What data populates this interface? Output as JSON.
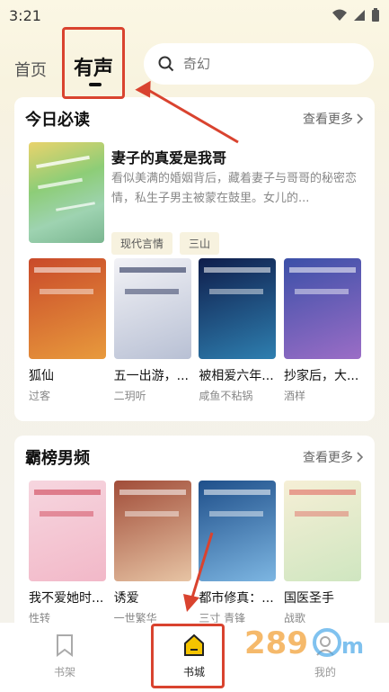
{
  "status": {
    "time": "3:21"
  },
  "top_tabs": {
    "home": "首页",
    "audio": "有声"
  },
  "search": {
    "placeholder": "奇幻"
  },
  "section1": {
    "title": "今日必读",
    "more": "查看更多",
    "feature": {
      "title": "妻子的真爱是我哥",
      "desc": "看似美满的婚姻背后，藏着妻子与哥哥的秘密恋情，私生子男主被蒙在鼓里。女儿的...",
      "tags": [
        "现代言情",
        "三山"
      ]
    },
    "books": [
      {
        "title": "狐仙",
        "author": "过客",
        "color_a": "#c94a2a",
        "color_b": "#e89a3c"
      },
      {
        "title": "五一出游，...",
        "author": "二玥听",
        "color_a": "#e9e9ee",
        "color_b": "#b8c0d4"
      },
      {
        "title": "被相爱六年...",
        "author": "咸鱼不粘锅",
        "color_a": "#0f1d4b",
        "color_b": "#2e7fb0"
      },
      {
        "title": "抄家后，大...",
        "author": "酒样",
        "color_a": "#3b50a8",
        "color_b": "#9b6dc6"
      }
    ]
  },
  "section2": {
    "title": "霸榜男频",
    "more": "查看更多",
    "books": [
      {
        "title": "我不爱她时...",
        "author": "性转",
        "color_a": "#f6d6df",
        "color_b": "#f2b8c8"
      },
      {
        "title": "诱爱",
        "author": "一世繁华",
        "color_a": "#a14d39",
        "color_b": "#e7c4a4"
      },
      {
        "title": "都市修真：...",
        "author": "三寸 青锋",
        "color_a": "#1f4f8a",
        "color_b": "#7db6e2"
      },
      {
        "title": "国医圣手",
        "author": "战歌",
        "color_a": "#f6efd6",
        "color_b": "#cfe6c0"
      }
    ]
  },
  "bottom_nav": {
    "shelf": "书架",
    "store": "书城",
    "mine": "我的"
  },
  "colors": {
    "accent": "#f5c400",
    "annotation": "#d9432f"
  }
}
